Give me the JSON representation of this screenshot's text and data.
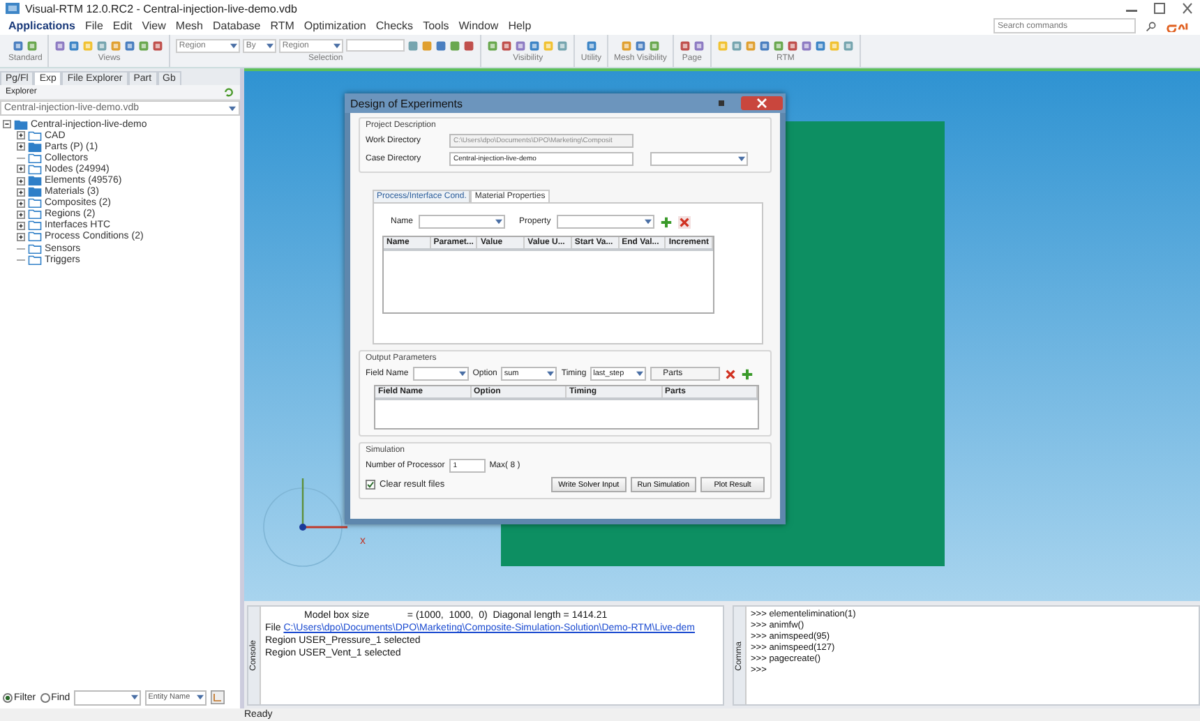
{
  "window": {
    "title": "Visual-RTM 12.0.RC2 - Central-injection-live-demo.vdb"
  },
  "menu": {
    "application": "Applications",
    "items": [
      "File",
      "Edit",
      "View",
      "Mesh",
      "Database",
      "RTM",
      "Optimization",
      "Checks",
      "Tools",
      "Window",
      "Help"
    ]
  },
  "search": {
    "placeholder": "Search commands"
  },
  "toolbar": {
    "groups": [
      {
        "label": "Standard",
        "kind": "icons"
      },
      {
        "label": "Views",
        "kind": "icons"
      },
      {
        "label": "Selection",
        "kind": "selection",
        "dropdowns": [
          "Region",
          "By",
          "Region"
        ]
      },
      {
        "label": "Visibility",
        "kind": "icons"
      },
      {
        "label": "Utility",
        "kind": "icons"
      },
      {
        "label": "Mesh Visibility",
        "kind": "icons"
      },
      {
        "label": "Page",
        "kind": "icons"
      },
      {
        "label": "RTM",
        "kind": "icons"
      }
    ]
  },
  "explorer": {
    "tabs": [
      {
        "label": "Pg/Fl",
        "selected": false
      },
      {
        "label": "Exp",
        "selected": true
      },
      {
        "label": "File Explorer",
        "selected": false
      },
      {
        "label": "Part",
        "selected": false
      },
      {
        "label": "Gb",
        "selected": false
      }
    ],
    "header": "Explorer",
    "file": "Central-injection-live-demo.vdb",
    "tree": [
      {
        "label": "Central-injection-live-demo",
        "filled": true,
        "expanded": true,
        "children": [
          {
            "label": "CAD",
            "filled": false,
            "expanded": false
          },
          {
            "label": "Parts (P) (1)",
            "filled": true,
            "expanded": false
          },
          {
            "label": "Collectors",
            "filled": false
          },
          {
            "label": "Nodes (24994)",
            "filled": false,
            "expanded": false
          },
          {
            "label": "Elements (49576)",
            "filled": true,
            "expanded": false
          },
          {
            "label": "Materials (3)",
            "filled": true,
            "expanded": false
          },
          {
            "label": "Composites (2)",
            "filled": false,
            "expanded": false
          },
          {
            "label": "Regions (2)",
            "filled": false,
            "expanded": false
          },
          {
            "label": "Interfaces HTC",
            "filled": false,
            "expanded": false
          },
          {
            "label": "Process Conditions (2)",
            "filled": false,
            "expanded": false
          },
          {
            "label": "Sensors",
            "filled": false
          },
          {
            "label": "Triggers",
            "filled": false
          }
        ]
      }
    ]
  },
  "filter": {
    "modes": [
      {
        "label": "Filter",
        "selected": true
      },
      {
        "label": "Find",
        "selected": false
      }
    ],
    "entity": "Entity Name"
  },
  "viewport": {
    "axis_label": "x"
  },
  "dialog": {
    "title": "Design of Experiments",
    "project": {
      "legend": "Project Description",
      "fields": [
        {
          "label": "Work Directory",
          "value": "C:\\Users\\dpo\\Documents\\DPO\\Marketing\\Composit",
          "disabled": true
        },
        {
          "label": "Case Directory",
          "value": "Central-injection-live-demo",
          "disabled": false
        }
      ]
    },
    "tabs": [
      {
        "label": "Process/Interface Cond.",
        "selected": false
      },
      {
        "label": "Material Properties",
        "selected": true
      }
    ],
    "material": {
      "name_label": "Name",
      "property_label": "Property",
      "columns": [
        "Name",
        "Paramet...",
        "Value",
        "Value U...",
        "Start Va...",
        "End Val...",
        "Increment"
      ]
    },
    "output": {
      "legend": "Output Parameters",
      "field_label": "Field Name",
      "option_label": "Option",
      "option": "sum",
      "timing_label": "Timing",
      "timing": "last_step",
      "parts": "Parts",
      "columns": [
        "Field Name",
        "Option",
        "Timing",
        "Parts"
      ]
    },
    "simulation": {
      "legend": "Simulation",
      "processor_label": "Number of Processor",
      "processors": "1",
      "max": "Max( 8 )",
      "clear_results": {
        "label": "Clear result files",
        "checked": true
      },
      "buttons": [
        "Write Solver Input",
        "Run Simulation",
        "Plot Result"
      ]
    }
  },
  "console": {
    "title": "Console",
    "lines": [
      {
        "kind": "indented",
        "text": "Model box size              = (1000,  1000,  0)  Diagonal length = 1414.21"
      },
      {
        "kind": "link",
        "text": "File",
        "link": "C:\\Users\\dpo\\Documents\\DPO\\Marketing\\Composite-Simulation-Solution\\Demo-RTM\\Live-dem"
      },
      {
        "kind": "text",
        "text": "Region USER_Pressure_1 selected"
      },
      {
        "kind": "text",
        "text": "Region USER_Vent_1 selected"
      }
    ]
  },
  "commands": {
    "title": "Comma",
    "lines": [
      ">>> elementelimination(1)",
      ">>> animfw()",
      ">>> animspeed(95)",
      ">>> animspeed(127)",
      ">>> pagecreate()",
      ">>>"
    ]
  },
  "status_bar": {
    "text": "Ready"
  }
}
